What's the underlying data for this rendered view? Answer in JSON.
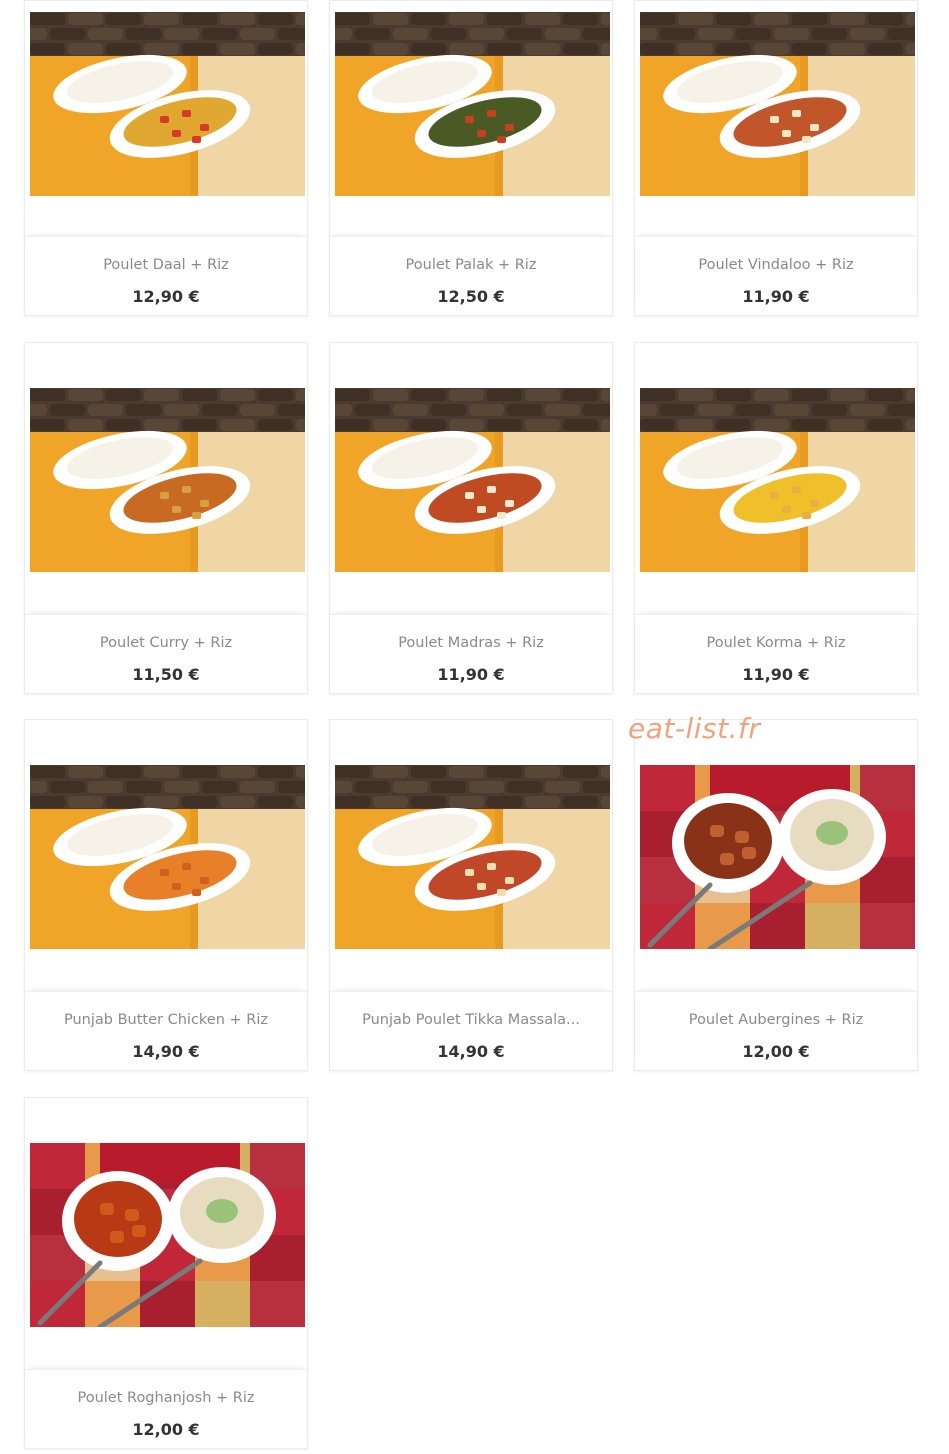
{
  "products": [
    {
      "name": "Poulet Daal + Riz",
      "price": "12,90 €",
      "sauce": "#e0a830",
      "scene": "wood",
      "garnish": "#d83a2a"
    },
    {
      "name": "Poulet Palak + Riz",
      "price": "12,50 €",
      "sauce": "#4a5a24",
      "scene": "wood",
      "garnish": "#c84020"
    },
    {
      "name": "Poulet Vindaloo + Riz",
      "price": "11,90 €",
      "sauce": "#c0562a",
      "scene": "wood",
      "garnish": "#f4e8c4"
    },
    {
      "name": "Poulet Curry + Riz",
      "price": "11,50 €",
      "sauce": "#c86a22",
      "scene": "wood",
      "garnish": "#d8a040"
    },
    {
      "name": "Poulet Madras + Riz",
      "price": "11,90 €",
      "sauce": "#c04a22",
      "scene": "wood",
      "garnish": "#f4e8d0"
    },
    {
      "name": "Poulet Korma + Riz",
      "price": "11,90 €",
      "sauce": "#f0c02a",
      "scene": "wood",
      "garnish": "#e8b040"
    },
    {
      "name": "Punjab Butter Chicken + Riz",
      "price": "14,90 €",
      "sauce": "#e8802a",
      "scene": "wood",
      "garnish": "#d06020"
    },
    {
      "name": "Punjab Poulet Tikka Massala...",
      "price": "14,90 €",
      "sauce": "#c04828",
      "scene": "wood",
      "garnish": "#f0e0b0"
    },
    {
      "name": "Poulet Aubergines + Riz",
      "price": "12,00 €",
      "sauce": "#8a3218",
      "scene": "fabric",
      "garnish": "#c06030"
    },
    {
      "name": "Poulet Roghanjosh + Riz",
      "price": "12,00 €",
      "sauce": "#b83a14",
      "scene": "fabric",
      "garnish": "#d05a1a"
    }
  ],
  "watermark": "eat-list.fr",
  "colors": {
    "price": "#333333",
    "name": "#8a8a8a",
    "watermark": "#f1a37e"
  }
}
